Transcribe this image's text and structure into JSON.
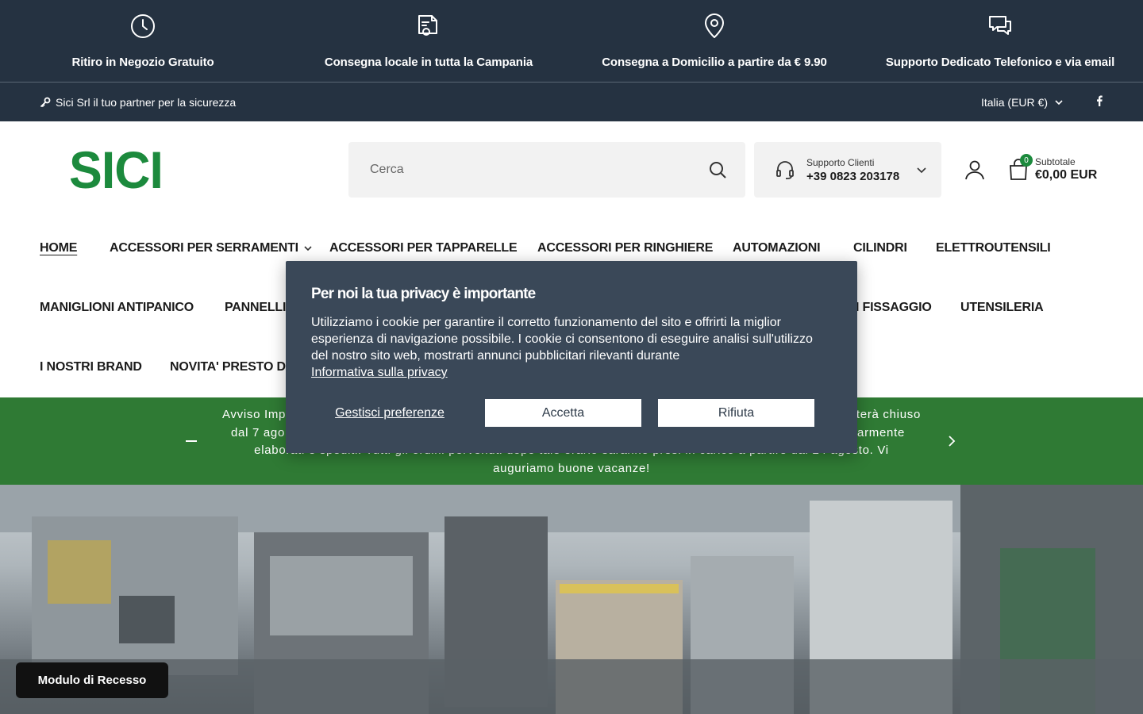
{
  "features": [
    {
      "icon": "clock-icon",
      "label": "Ritiro in Negozio Gratuito"
    },
    {
      "icon": "delivery-truck-icon",
      "label": "Consegna locale in tutta la Campania"
    },
    {
      "icon": "map-pin-icon",
      "label": "Consegna a Domicilio a partire da € 9.90"
    },
    {
      "icon": "chat-bubbles-icon",
      "label": "Supporto Dedicato Telefonico e via email"
    }
  ],
  "topstrip": {
    "tagline": "Sici Srl il tuo partner per la sicurezza",
    "country": "Italia (EUR €)"
  },
  "header": {
    "logo": "SICI",
    "brand_color": "#1c8a3d",
    "search_placeholder": "Cerca",
    "support_label": "Supporto Clienti",
    "support_phone": "+39 0823 203178",
    "cart_count": "0",
    "subtotal_label": "Subtotale",
    "subtotal_amount": "€0,00 EUR"
  },
  "nav": {
    "home": "HOME",
    "serramenti": "ACCESSORI PER SERRAMENTI",
    "tapparelle": "ACCESSORI PER TAPPARELLE",
    "ringhiere": "ACCESSORI PER RINGHIERE",
    "automazioni": "AUTOMAZIONI",
    "cilindri": "CILINDRI",
    "elettroutensili": "ELETTROUTENSILI",
    "maniglioni": "MANIGLIONI ANTIPANICO",
    "pannelli": "PANNELLI",
    "fissaggio": "I FISSAGGIO",
    "utensileria": "UTENSILERIA",
    "brand": "I NOSTRI BRAND",
    "novita": "NOVITA' PRESTO DI"
  },
  "notice": {
    "text": "Avviso Imp                                                                                                          terà chiuso dal 7 ago                                                                                                            olarmente elaborati e spediti. Tutti gli ordini pervenuti dopo tale orario saranno presi in carico a partire dal 24 agosto. Vi auguriamo buone vacanze!",
    "line1_left": "Avviso Imp",
    "line1_right": "terà chiuso",
    "line2_left": "dal 7 ago",
    "line2_right": "olarmente",
    "line3": "elaborati e spediti. Tutti gli ordini pervenuti dopo tale orario saranno presi in carico a partire dal 24 agosto. Vi",
    "line4": "auguriamo buone vacanze!"
  },
  "cookie": {
    "title": "Per noi la tua privacy è importante",
    "body": "Utilizziamo i cookie per garantire il corretto funzionamento del sito e offrirti la miglior esperienza di navigazione possibile. I cookie ci consentono di eseguire analisi sull'utilizzo del nostro sito web, mostrarti annunci pubblicitari rilevanti durante",
    "link": "Informativa sulla privacy",
    "manage": "Gestisci preferenze",
    "accept": "Accetta",
    "reject": "Rifiuta"
  },
  "withdrawal_button": "Modulo di Recesso"
}
